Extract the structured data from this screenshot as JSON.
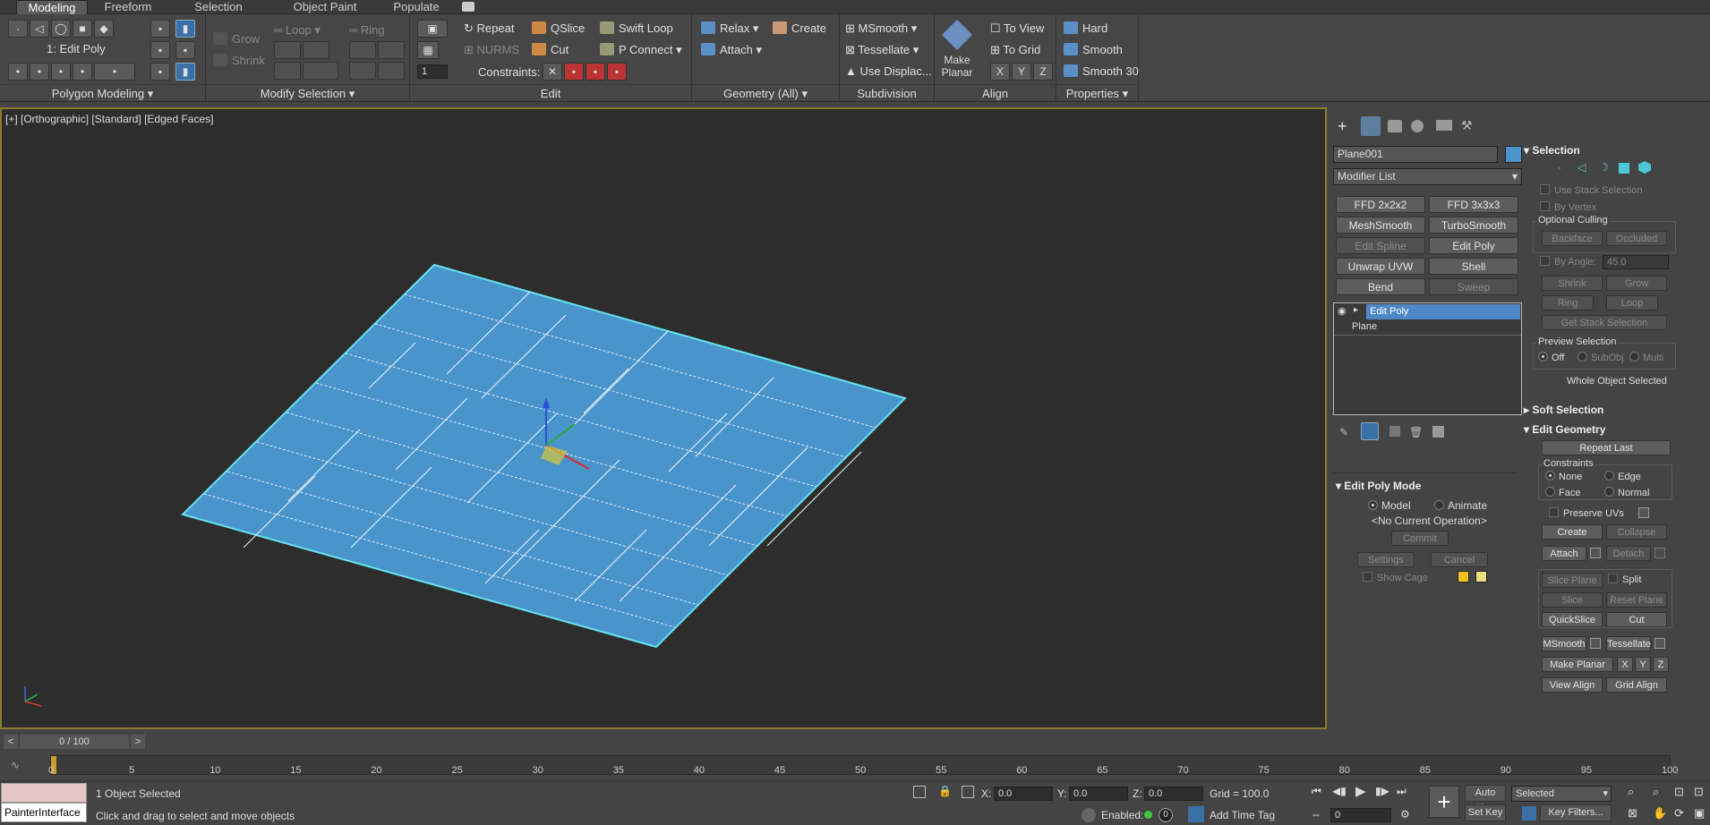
{
  "tabs": [
    "Modeling",
    "Freeform",
    "Selection",
    "Object Paint",
    "Populate"
  ],
  "ribbon": {
    "polygon_modeling": {
      "level": "1: Edit Poly",
      "title": "Polygon Modeling"
    },
    "modify_selection": {
      "grow": "Grow",
      "shrink": "Shrink",
      "loop": "Loop",
      "ring": "Ring",
      "title": "Modify Selection"
    },
    "edit": {
      "repeat": "Repeat",
      "qslice": "QSlice",
      "swift_loop": "Swift Loop",
      "nurms": "NURMS",
      "cut": "Cut",
      "p_connect": "P Connect",
      "constraints": "Constraints:",
      "title": "Edit"
    },
    "geometry": {
      "relax": "Relax",
      "create": "Create",
      "attach": "Attach",
      "title": "Geometry (All)"
    },
    "subdivision": {
      "msmooth": "MSmooth",
      "tessellate": "Tessellate",
      "use_displace": "Use Displac...",
      "title": "Subdivision"
    },
    "align": {
      "make_planar": "Make Planar",
      "to_view": "To View",
      "to_grid": "To Grid",
      "x": "X",
      "y": "Y",
      "z": "Z",
      "title": "Align"
    },
    "properties": {
      "hard": "Hard",
      "smooth": "Smooth",
      "smooth30": "Smooth 30",
      "title": "Properties"
    }
  },
  "viewport": {
    "label": "[+] [Orthographic] [Standard] [Edged Faces]"
  },
  "cmd": {
    "object_name": "Plane001",
    "modifier_list": "Modifier List",
    "buttons": [
      [
        "FFD 2x2x2",
        "FFD 3x3x3"
      ],
      [
        "MeshSmooth",
        "TurboSmooth"
      ],
      [
        "Edit Spline",
        "Edit Poly"
      ],
      [
        "Unwrap UVW",
        "Shell"
      ],
      [
        "Bend",
        "Sweep"
      ]
    ],
    "stack": [
      "Edit Poly",
      "Plane"
    ],
    "edit_poly_mode": {
      "title": "Edit Poly Mode",
      "model": "Model",
      "animate": "Animate",
      "current": "<No Current Operation>",
      "commit": "Commit",
      "settings": "Settings",
      "cancel": "Cancel",
      "show_cage": "Show Cage"
    }
  },
  "selection": {
    "title": "Selection",
    "use_stack": "Use Stack Selection",
    "by_vertex": "By Vertex",
    "optional_culling": "Optional Culling",
    "backface": "Backface",
    "occluded": "Occluded",
    "by_angle": "By Angle:",
    "angle": "45.0",
    "shrink": "Shrink",
    "grow": "Grow",
    "ring": "Ring",
    "loop": "Loop",
    "get_stack": "Get Stack Selection",
    "preview": "Preview Selection",
    "off": "Off",
    "subobj": "SubObj",
    "multi": "Multi",
    "whole": "Whole Object Selected"
  },
  "soft_selection": "Soft Selection",
  "edit_geometry": {
    "title": "Edit Geometry",
    "repeat_last": "Repeat Last",
    "constraints": "Constraints",
    "none": "None",
    "edge": "Edge",
    "face": "Face",
    "normal": "Normal",
    "preserve_uvs": "Preserve UVs",
    "create": "Create",
    "collapse": "Collapse",
    "attach": "Attach",
    "detach": "Detach",
    "slice_plane": "Slice Plane",
    "split": "Split",
    "slice": "Slice",
    "reset_plane": "Reset Plane",
    "quickslice": "QuickSlice",
    "cut": "Cut",
    "msmooth": "MSmooth",
    "tessellate": "Tessellate",
    "make_planar": "Make Planar",
    "x": "X",
    "y": "Y",
    "z": "Z",
    "view_align": "View Align",
    "grid_align": "Grid Align"
  },
  "timeline": {
    "frame": "0 / 100",
    "ticks": [
      "0",
      "5",
      "10",
      "15",
      "20",
      "25",
      "30",
      "35",
      "40",
      "45",
      "50",
      "55",
      "60",
      "65",
      "70",
      "75",
      "80",
      "85",
      "90",
      "95",
      "100"
    ]
  },
  "status": {
    "script": "PainterInterface",
    "selected": "1 Object Selected",
    "prompt": "Click and drag to select and move objects",
    "x_label": "X:",
    "x": "0.0",
    "y_label": "Y:",
    "y": "0.0",
    "z_label": "Z:",
    "z": "0.0",
    "grid": "Grid = 100.0",
    "enabled": "Enabled:",
    "add_time_tag": "Add Time Tag",
    "auto_key": "Auto Key",
    "set_key": "Set Key",
    "selected_dd": "Selected",
    "key_filters": "Key Filters...",
    "frame_field": "0"
  }
}
